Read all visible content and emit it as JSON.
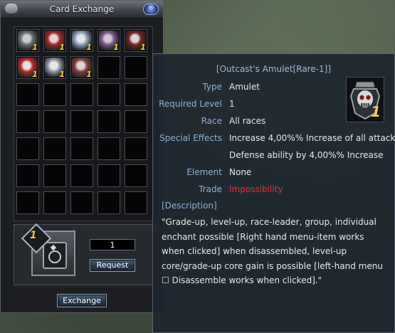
{
  "window": {
    "title": "Card Exchange",
    "close_label": "∞",
    "exchange_label": "Exchange"
  },
  "grid": {
    "cards": [
      {
        "name": "card-ring-silver",
        "count": "1",
        "colors": [
          "#c9ccd0",
          "#6a6e73",
          "#2a2c2f"
        ]
      },
      {
        "name": "card-skull-red",
        "count": "1",
        "colors": [
          "#d9d9d9",
          "#b22222",
          "#2b2b2b"
        ]
      },
      {
        "name": "card-crystal-blade",
        "count": "1",
        "colors": [
          "#e6e6e6",
          "#8aa0b8",
          "#2a2f36"
        ]
      },
      {
        "name": "card-ring-violet",
        "count": "1",
        "colors": [
          "#d0c6d4",
          "#7a5a86",
          "#2b2330"
        ]
      },
      {
        "name": "card-amulet-skull",
        "count": "1",
        "colors": [
          "#d8d8d8",
          "#7a2222",
          "#222222"
        ]
      },
      {
        "name": "card-helm-red",
        "count": "1",
        "colors": [
          "#e3e3e3",
          "#c02424",
          "#2a2a2a"
        ]
      },
      {
        "name": "card-star-blade",
        "count": "1",
        "colors": [
          "#e8e8e8",
          "#8c949c",
          "#25292d"
        ]
      },
      {
        "name": "card-necklace",
        "count": "1",
        "colors": [
          "#d5d5d5",
          "#8a3a3a",
          "#2a2a2a"
        ]
      }
    ]
  },
  "lower": {
    "badge_number": "1",
    "quantity": "1",
    "request_label": "Request"
  },
  "tooltip": {
    "title": "[Outcast's Amulet[Rare-1]]",
    "icon_number": "1",
    "rows": [
      {
        "label": "Type",
        "value": "Amulet"
      },
      {
        "label": "Required Level",
        "value": "1"
      },
      {
        "label": "Race",
        "value": "All races"
      },
      {
        "label": "Special Effects",
        "value": "Increase 4,00%% Increase of all attack"
      },
      {
        "label": "",
        "value": "Defense ability by 4,00%% Increase"
      },
      {
        "label": "Element",
        "value": "None"
      },
      {
        "label": "Trade",
        "value": "Impossibility"
      }
    ],
    "description_label": "[Description]",
    "description": "\"Grade-up, level-up, race-leader, group, individual enchant possible [Right hand menu-item  works when clicked] when disassembled, level-up core/grade-up core gain is possible [left-hand menu ☐ Disassemble works when clicked].\""
  }
}
